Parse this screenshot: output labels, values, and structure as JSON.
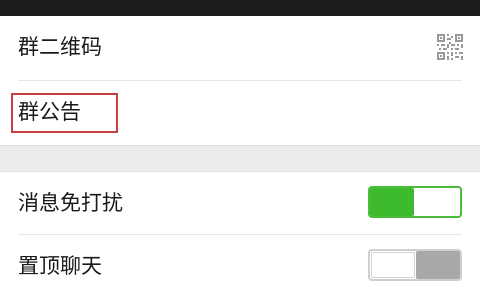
{
  "rows": {
    "qr_code": {
      "label": "群二维码",
      "icon": "qr-code-icon"
    },
    "announcement": {
      "label": "群公告"
    },
    "mute_notifications": {
      "label": "消息免打扰",
      "toggle_on": true
    },
    "pin_chat": {
      "label": "置顶聊天",
      "toggle_on": false
    }
  },
  "colors": {
    "toggle_on": "#3dbb2d",
    "toggle_off": "#a8a8a8",
    "highlight_border": "#c94040",
    "section_gap": "#ececec"
  }
}
